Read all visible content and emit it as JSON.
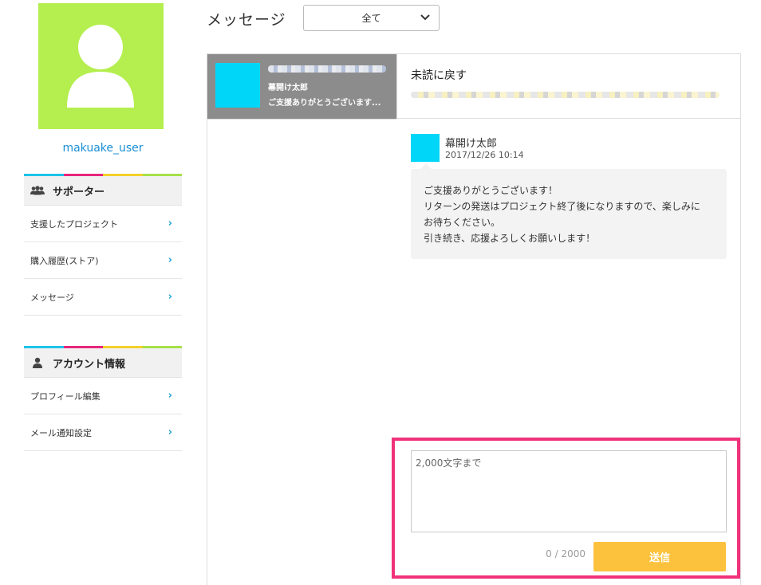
{
  "sidebar": {
    "username": "makuake_user",
    "avatar_color": "#b4ef4f",
    "stripe_colors": [
      "#1ec4e8",
      "#e8267d",
      "#f4d02b",
      "#a6e04a"
    ],
    "supporter": {
      "heading": "サポーター",
      "icon": "group-icon",
      "items": [
        {
          "label": "支援したプロジェクト"
        },
        {
          "label": "購入履歴(ストア)"
        },
        {
          "label": "メッセージ"
        }
      ]
    },
    "account": {
      "heading": "アカウント情報",
      "icon": "person-icon",
      "items": [
        {
          "label": "プロフィール編集"
        },
        {
          "label": "メール通知設定"
        }
      ]
    }
  },
  "header": {
    "title": "メッセージ",
    "filter": {
      "selected": "全て"
    }
  },
  "thread": {
    "sender": "幕開け太郎",
    "preview": "ご支援ありがとうございます...",
    "bg_color": "#8c8c8c",
    "thumb_color": "#00d6f7"
  },
  "conversation": {
    "mark_unread": "未読に戻す",
    "message": {
      "sender": "幕開け太郎",
      "timestamp": "2017/12/26 10:14",
      "lines": [
        "ご支援ありがとうございます！",
        "リターンの発送はプロジェクト終了後になりますので、楽しみに",
        "お待ちください。",
        "引き続き、応援よろしくお願いします！"
      ]
    }
  },
  "compose": {
    "placeholder": "2,000文字まで",
    "count": "0 / 2000",
    "send_label": "送信",
    "highlight_color": "#f0327a",
    "send_color": "#fcc23d"
  }
}
